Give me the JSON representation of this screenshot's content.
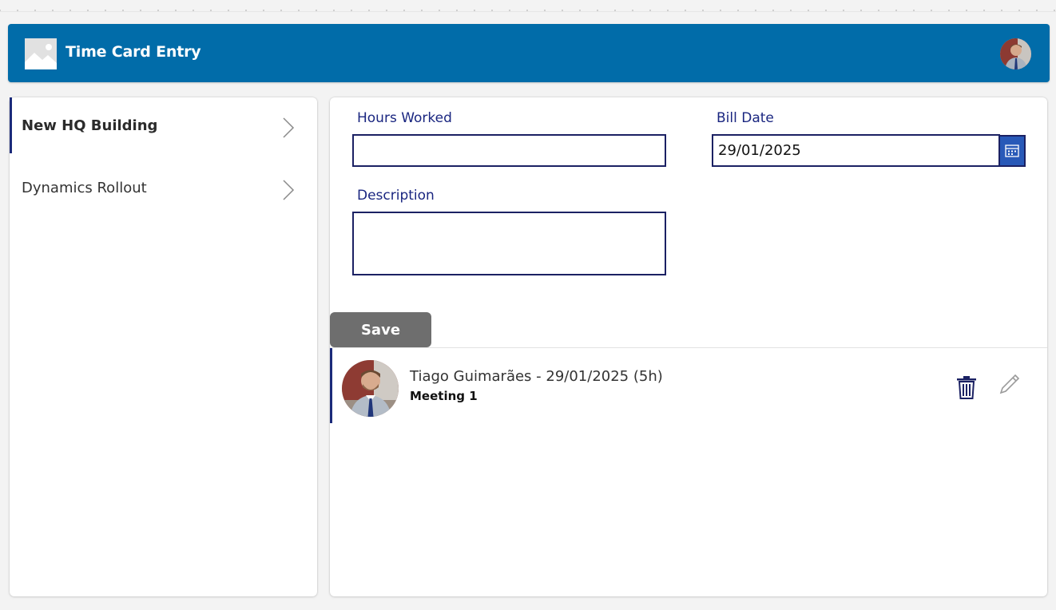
{
  "header": {
    "title": "Time Card Entry",
    "logo_icon": "image-placeholder-icon",
    "user_avatar": "user-avatar"
  },
  "projects": [
    {
      "label": "New HQ Building",
      "selected": true
    },
    {
      "label": "Dynamics Rollout",
      "selected": false
    }
  ],
  "form": {
    "hours_label": "Hours Worked",
    "hours_value": "",
    "bill_date_label": "Bill Date",
    "bill_date_value": "29/01/2025",
    "description_label": "Description",
    "description_value": "",
    "save_label": "Save"
  },
  "entries": [
    {
      "title": "Tiago Guimarães - 29/01/2025 (5h)",
      "subtitle": "Meeting 1",
      "icons": [
        "trash-icon",
        "pencil-icon"
      ]
    }
  ],
  "colors": {
    "header_bg": "#016ca9",
    "accent": "#1b2a7a",
    "label": "#1a2680",
    "calendar_btn": "#2859b8",
    "save_btn": "#6e6e6e"
  }
}
